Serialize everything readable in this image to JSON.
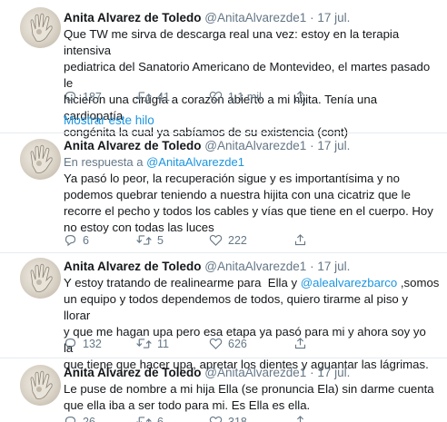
{
  "tweets": [
    {
      "name": "Anita Alvarez de Toledo",
      "handle": "@AnitaAlvarezde1",
      "sep": "·",
      "date": "17 jul.",
      "reply_prefix": "",
      "reply_handle": "",
      "text_lines": [
        "Que TW me sirva de descarga real una vez: estoy en la terapia intensiva",
        "pediatrica del Sanatorio Americano de Montevideo, el martes pasado le",
        "hicieron una cirugía a corazón abierto a mi hijita. Tenía una cardiopatía",
        "congénita la cual ya sabíamos de su existencia (cont)"
      ],
      "replies": "187",
      "retweets": "41",
      "likes": "1,1 mil"
    },
    {
      "name": "Anita Alvarez de Toledo",
      "handle": "@AnitaAlvarezde1",
      "sep": "·",
      "date": "17 jul.",
      "reply_prefix": "En respuesta a",
      "reply_handle": "@AnitaAlvarezde1",
      "text_lines": [
        "Ya pasó lo peor, la recuperación sigue y es importantísima y no",
        "podemos quebrar teniendo a nuestra hijita con una cicatriz que le",
        "recorre el pecho y todos los cables y vías que tiene en el cuerpo. Hoy",
        "no estoy con todas las luces"
      ],
      "replies": "6",
      "retweets": "5",
      "likes": "222"
    },
    {
      "name": "Anita Alvarez de Toledo",
      "handle": "@AnitaAlvarezde1",
      "sep": "·",
      "date": "17 jul.",
      "text_line1_a": "Y estoy tratando de realinearme para  Ella y ",
      "text_mention": "@alealvarezbarco",
      "text_line1_b": " ,somos",
      "text_lines": [
        "un equipo y todos dependemos de todos, quiero tirarme al piso y llorar",
        "y que me hagan upa pero esa etapa ya pasó para mi y ahora soy yo la",
        "que tiene que hacer upa, apretar los dientes y aguantar las lágrimas."
      ],
      "replies": "132",
      "retweets": "11",
      "likes": "626"
    },
    {
      "name": "Anita Alvarez de Toledo",
      "handle": "@AnitaAlvarezde1",
      "sep": "·",
      "date": "17 jul.",
      "text_lines": [
        "Le puse de nombre a mi hija Ella (se pronuncia Ela) sin darme cuenta",
        "que ella iba a ser todo para mi. Es Ella es ella."
      ],
      "replies": "26",
      "retweets": "6",
      "likes": "318"
    }
  ],
  "show_thread_label": "Mostrar este hilo",
  "icons": {
    "reply": "reply-icon",
    "retweet": "retweet-icon",
    "like": "heart-icon",
    "share": "share-icon"
  },
  "colors": {
    "link": "#1b95e0",
    "muted": "#657786",
    "text": "#14171a",
    "divider": "#e6ecf0"
  }
}
